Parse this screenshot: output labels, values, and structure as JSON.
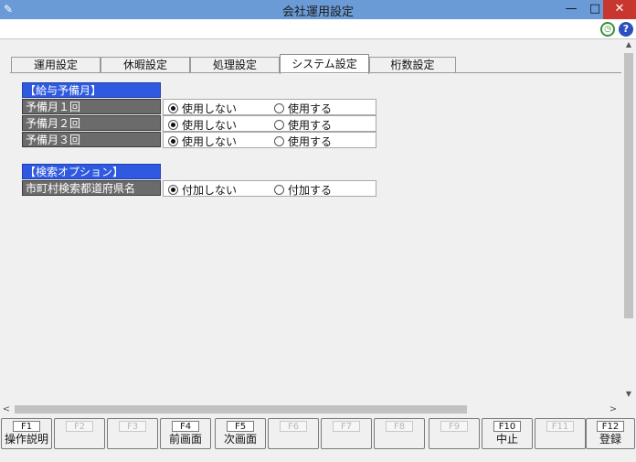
{
  "window": {
    "title": "会社運用設定",
    "minimize": "—",
    "maximize": "□",
    "close": "✕"
  },
  "toolbar": {
    "history_icon": "clock-icon",
    "help_icon": "help-icon",
    "help_glyph": "?"
  },
  "tabs": [
    {
      "label": "運用設定",
      "active": false
    },
    {
      "label": "休暇設定",
      "active": false
    },
    {
      "label": "処理設定",
      "active": false
    },
    {
      "label": "システム設定",
      "active": true
    },
    {
      "label": "桁数設定",
      "active": false
    }
  ],
  "sections": {
    "bonus": {
      "header": "【給与予備月】",
      "rows": [
        {
          "label": "予備月１回",
          "option_off": "使用しない",
          "option_on": "使用する",
          "selected": "off"
        },
        {
          "label": "予備月２回",
          "option_off": "使用しない",
          "option_on": "使用する",
          "selected": "off"
        },
        {
          "label": "予備月３回",
          "option_off": "使用しない",
          "option_on": "使用する",
          "selected": "off"
        }
      ]
    },
    "search": {
      "header": "【検索オプション】",
      "rows": [
        {
          "label": "市町村検索都道府県名",
          "option_off": "付加しない",
          "option_on": "付加する",
          "selected": "off"
        }
      ]
    }
  },
  "scroll": {
    "left": "<",
    "right": ">",
    "up": "▲",
    "down": "▼"
  },
  "function_keys": [
    {
      "key": "F1",
      "caption": "操作説明",
      "enabled": true
    },
    {
      "key": "F2",
      "caption": "",
      "enabled": false
    },
    {
      "key": "F3",
      "caption": "",
      "enabled": false
    },
    {
      "key": "F4",
      "caption": "前画面",
      "enabled": true
    },
    {
      "key": "F5",
      "caption": "次画面",
      "enabled": true
    },
    {
      "key": "F6",
      "caption": "",
      "enabled": false
    },
    {
      "key": "F7",
      "caption": "",
      "enabled": false
    },
    {
      "key": "F8",
      "caption": "",
      "enabled": false
    },
    {
      "key": "F9",
      "caption": "",
      "enabled": false
    },
    {
      "key": "F10",
      "caption": "中止",
      "enabled": true
    },
    {
      "key": "F11",
      "caption": "",
      "enabled": false
    },
    {
      "key": "F12",
      "caption": "登録",
      "enabled": true
    }
  ]
}
